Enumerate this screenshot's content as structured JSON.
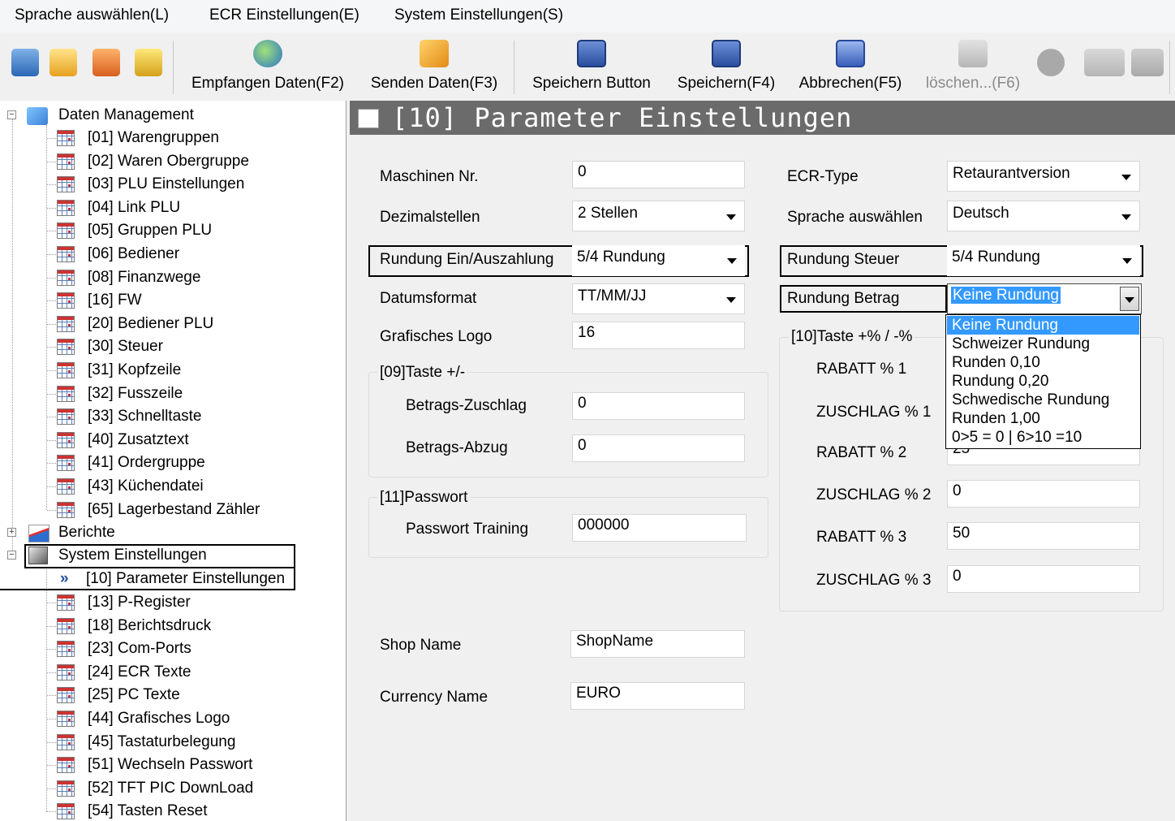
{
  "menu": [
    "Sprache auswählen(L)",
    "ECR Einstellungen(E)",
    "System Einstellungen(S)"
  ],
  "toolbar": {
    "small_icons": [
      "info-icon",
      "check-icon",
      "chart-icon",
      "list-icon"
    ],
    "buttons": [
      {
        "label": "Empfangen Daten(F2)",
        "icon": "globe-download-icon",
        "enabled": true
      },
      {
        "label": "Senden Daten(F3)",
        "icon": "send-icon",
        "enabled": true
      },
      {
        "label": "Speichern Button",
        "icon": "save-icon",
        "enabled": true
      },
      {
        "label": "Speichern(F4)",
        "icon": "save-icon",
        "enabled": true
      },
      {
        "label": "Abbrechen(F5)",
        "icon": "undo-icon",
        "enabled": true
      },
      {
        "label": "löschen...(F6)",
        "icon": "delete-icon",
        "enabled": false
      }
    ]
  },
  "tree": {
    "root1": {
      "label": "Daten Management",
      "items": [
        "[01] Warengruppen",
        "[02] Waren Obergruppe",
        "[03] PLU Einstellungen",
        "[04] Link PLU",
        "[05] Gruppen PLU",
        "[06] Bediener",
        "[08] Finanzwege",
        "[16] FW",
        "[20] Bediener PLU",
        "[30] Steuer",
        "[31] Kopfzeile",
        "[32] Fusszeile",
        "[33] Schnelltaste",
        "[40] Zusatztext",
        "[41] Ordergruppe",
        "[43] Küchendatei",
        "[65] Lagerbestand Zähler"
      ]
    },
    "root2": {
      "label": "Berichte"
    },
    "root3": {
      "label": "System Einstellungen",
      "selected": "[10] Parameter Einstellungen",
      "selected_marker": "»",
      "items": [
        "[13] P-Register",
        "[18] Berichtsdruck",
        "[23] Com-Ports",
        "[24] ECR Texte",
        "[25] PC Texte",
        "[44] Grafisches Logo",
        "[45] Tastaturbelegung",
        "[51] Wechseln Passwort",
        "[52] TFT PIC DownLoad",
        "[54] Tasten Reset"
      ]
    }
  },
  "panel": {
    "title": "[10] Parameter Einstellungen",
    "maschinen_nr": {
      "label": "Maschinen Nr.",
      "value": "0"
    },
    "dezimalstellen": {
      "label": "Dezimalstellen",
      "value": "2 Stellen"
    },
    "rundung_ein": {
      "label": "Rundung Ein/Auszahlung",
      "value": "5/4 Rundung"
    },
    "datumsformat": {
      "label": "Datumsformat",
      "value": "TT/MM/JJ"
    },
    "grafisches_logo": {
      "label": "Grafisches Logo",
      "value": "16"
    },
    "taste_pm": {
      "title": "[09]Taste +/-",
      "zuschlag": {
        "label": "Betrags-Zuschlag",
        "value": "0"
      },
      "abzug": {
        "label": "Betrags-Abzug",
        "value": "0"
      }
    },
    "passwort": {
      "title": "[11]Passwort",
      "training": {
        "label": "Passwort Training",
        "value": "000000"
      }
    },
    "shop_name": {
      "label": "Shop Name",
      "value": "ShopName"
    },
    "currency_name": {
      "label": "Currency Name",
      "value": "EURO"
    },
    "ecr_type": {
      "label": "ECR-Type",
      "value": "Retaurantversion"
    },
    "sprache": {
      "label": "Sprache auswählen",
      "value": "Deutsch"
    },
    "rundung_steuer": {
      "label": "Rundung Steuer",
      "value": "5/4 Rundung"
    },
    "rundung_betrag": {
      "label": "Rundung Betrag",
      "value": "Keine Rundung",
      "options": [
        "Keine Rundung",
        "Schweizer Rundung",
        "Runden 0,10",
        "Rundung 0,20",
        "Schwedische Rundung",
        "Runden 1,00",
        "0>5 = 0 | 6>10 =10"
      ],
      "highlighted_index": 0
    },
    "taste_pct": {
      "title": "[10]Taste +% / -%",
      "rows": [
        {
          "label": "RABATT % 1",
          "value": ""
        },
        {
          "label": "ZUSCHLAG % 1",
          "value": ""
        },
        {
          "label": "RABATT % 2",
          "value": "25"
        },
        {
          "label": "ZUSCHLAG % 2",
          "value": "0"
        },
        {
          "label": "RABATT % 3",
          "value": "50"
        },
        {
          "label": "ZUSCHLAG % 3",
          "value": "0"
        }
      ]
    }
  },
  "colors": {
    "title_bar": "#6b6b6b",
    "selection": "#3399ff",
    "highlight_border": "#000000"
  }
}
